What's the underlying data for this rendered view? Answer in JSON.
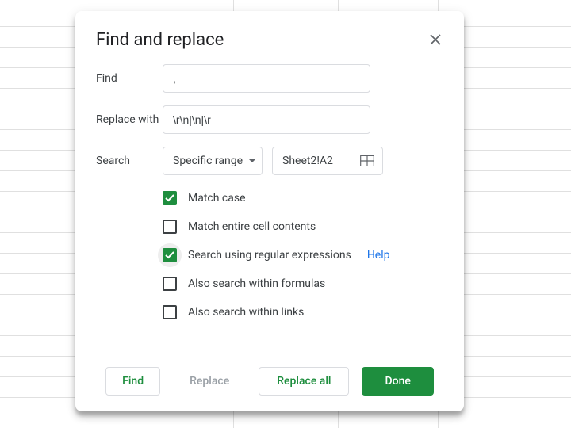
{
  "dialog": {
    "title": "Find and replace",
    "labels": {
      "find": "Find",
      "replace_with": "Replace with",
      "search": "Search"
    },
    "find_value": ",",
    "replace_value": "\\r\\n|\\n|\\r",
    "search_mode": "Specific range",
    "range_value": "Sheet2!A2",
    "checkboxes": {
      "match_case": {
        "label": "Match case",
        "checked": true
      },
      "entire_cell": {
        "label": "Match entire cell contents",
        "checked": false
      },
      "regex": {
        "label": "Search using regular expressions",
        "checked": true,
        "help": "Help"
      },
      "formulas": {
        "label": "Also search within formulas",
        "checked": false
      },
      "links": {
        "label": "Also search within links",
        "checked": false
      }
    },
    "buttons": {
      "find": "Find",
      "replace": "Replace",
      "replace_all": "Replace all",
      "done": "Done"
    }
  },
  "sheet": {
    "col_positions": [
      294,
      426,
      552,
      678
    ],
    "row_positions": [
      7,
      33,
      59,
      85,
      111,
      137,
      163,
      189,
      215,
      241,
      267,
      293,
      319,
      345,
      371,
      397,
      423,
      449,
      475,
      501,
      527
    ]
  }
}
